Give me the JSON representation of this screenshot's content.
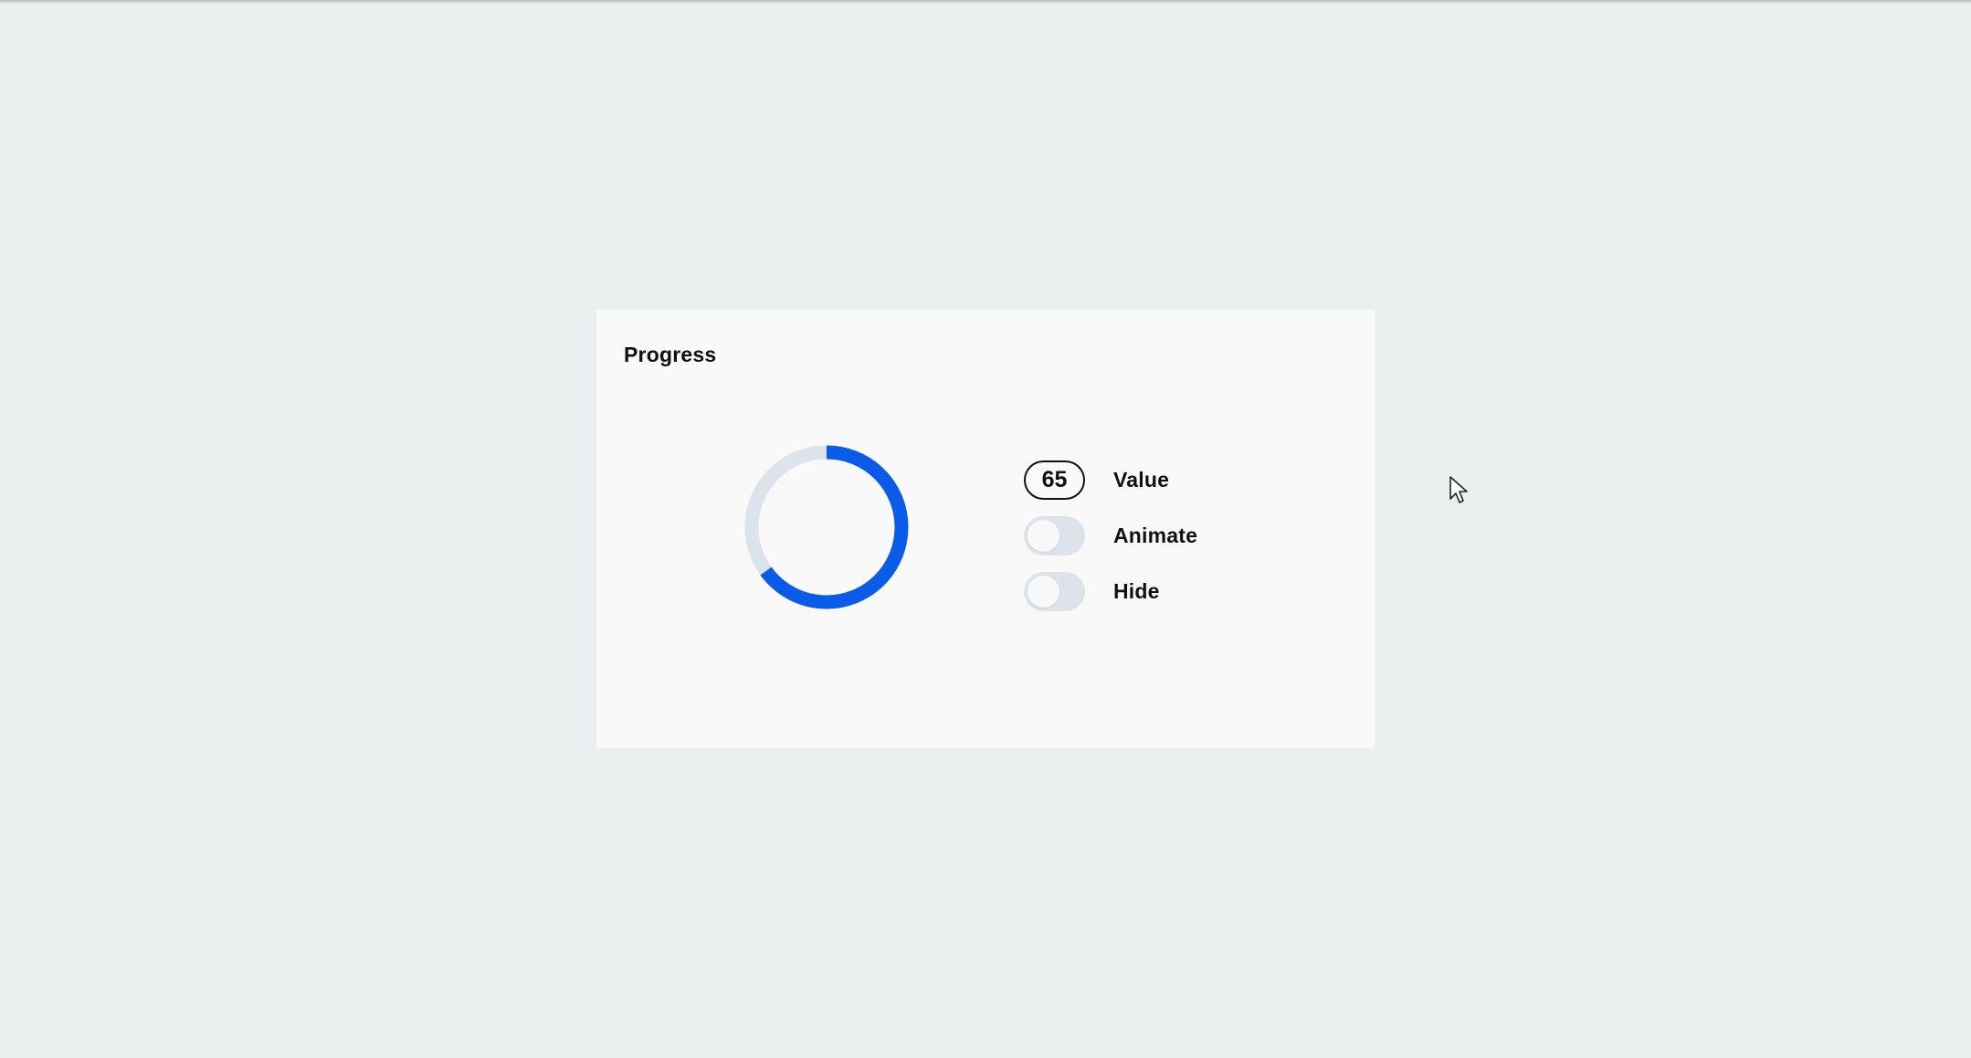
{
  "card": {
    "title": "Progress"
  },
  "progress": {
    "value": 65,
    "track_color": "#dde3ea",
    "fill_color": "#0a5ce8"
  },
  "controls": {
    "value": {
      "number": "65",
      "label": "Value"
    },
    "animate": {
      "label": "Animate",
      "checked": false
    },
    "hide": {
      "label": "Hide",
      "checked": false
    }
  },
  "icons": {
    "cursor": "mouse-pointer-icon"
  }
}
